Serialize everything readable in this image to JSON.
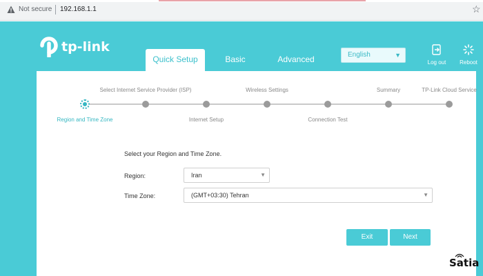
{
  "browser": {
    "security_text": "Not secure",
    "url": "192.168.1.1",
    "bookmark_icon": "star-icon"
  },
  "header": {
    "brand": "tp-link",
    "tabs": [
      {
        "label": "Quick Setup",
        "active": true
      },
      {
        "label": "Basic",
        "active": false
      },
      {
        "label": "Advanced",
        "active": false
      }
    ],
    "language": "English",
    "logout_label": "Log out",
    "reboot_label": "Reboot"
  },
  "wizard": {
    "steps": [
      {
        "label": "Region and Time Zone",
        "active": true
      },
      {
        "label": "Select Internet Service Provider (ISP)",
        "active": false
      },
      {
        "label": "Internet Setup",
        "active": false
      },
      {
        "label": "Wireless Settings",
        "active": false
      },
      {
        "label": "Connection Test",
        "active": false
      },
      {
        "label": "Summary",
        "active": false
      },
      {
        "label": "TP-Link Cloud Service",
        "active": false
      }
    ]
  },
  "form": {
    "title": "Select your Region and Time Zone.",
    "region_label": "Region:",
    "region_value": "Iran",
    "timezone_label": "Time Zone:",
    "timezone_value": "(GMT+03:30) Tehran",
    "exit_label": "Exit",
    "next_label": "Next"
  },
  "watermark": "Satia",
  "colors": {
    "accent": "#4acbd6",
    "active_step": "#36b7c2",
    "inactive_dot": "#9b9b9b"
  }
}
